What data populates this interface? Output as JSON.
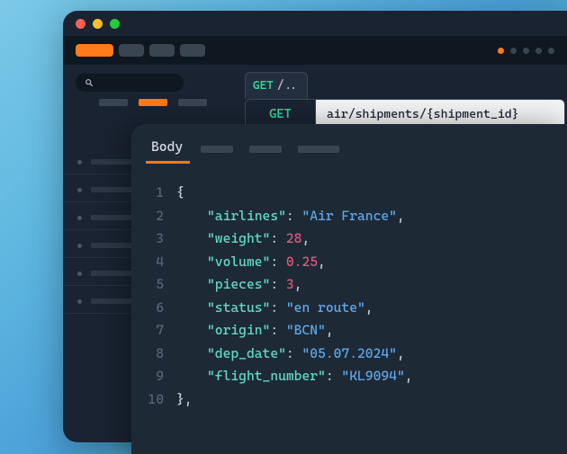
{
  "request": {
    "method_tab_label": "GET",
    "method_tab_suffix": "/..",
    "method": "GET",
    "url": "air/shipments/{shipment_id}"
  },
  "panel": {
    "active_tab": "Body"
  },
  "response_body": {
    "airlines": "Air France",
    "weight": 28,
    "volume": 0.25,
    "pieces": 3,
    "status": "en route",
    "origin": "BCN",
    "dep_date": "05.07.2024",
    "flight_number": "KL9094"
  },
  "code_lines": [
    {
      "n": 1,
      "kind": "brace-open"
    },
    {
      "n": 2,
      "kind": "pair",
      "key": "airlines",
      "vtype": "str",
      "path": "response_body.airlines",
      "comma": true
    },
    {
      "n": 3,
      "kind": "pair",
      "key": "weight",
      "vtype": "num",
      "path": "response_body.weight",
      "comma": true
    },
    {
      "n": 4,
      "kind": "pair",
      "key": "volume",
      "vtype": "num",
      "path": "response_body.volume",
      "comma": true
    },
    {
      "n": 5,
      "kind": "pair",
      "key": "pieces",
      "vtype": "num",
      "path": "response_body.pieces",
      "comma": true
    },
    {
      "n": 6,
      "kind": "pair",
      "key": "status",
      "vtype": "str",
      "path": "response_body.status",
      "comma": true
    },
    {
      "n": 7,
      "kind": "pair",
      "key": "origin",
      "vtype": "str",
      "path": "response_body.origin",
      "comma": true
    },
    {
      "n": 8,
      "kind": "pair",
      "key": "dep_date",
      "vtype": "str",
      "path": "response_body.dep_date",
      "comma": true
    },
    {
      "n": 9,
      "kind": "pair",
      "key": "flight_number",
      "vtype": "str",
      "path": "response_body.flight_number",
      "comma": true
    },
    {
      "n": 10,
      "kind": "brace-close",
      "comma": true
    }
  ]
}
